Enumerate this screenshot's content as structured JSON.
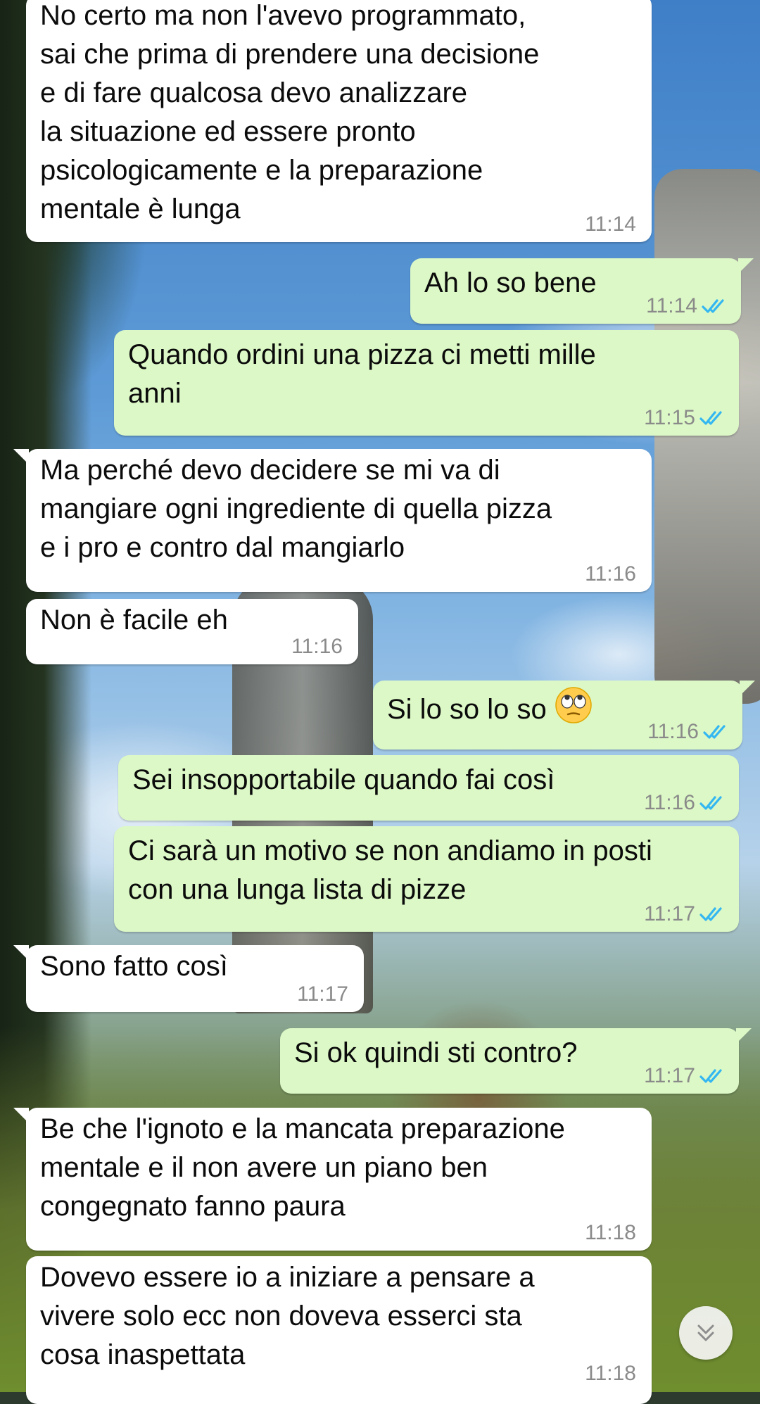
{
  "theme": {
    "incoming_bubble": "#ffffff",
    "outgoing_bubble": "#dcf8c6",
    "time_color": "#8a8a8a",
    "read_tick_color": "#34b7f1"
  },
  "messages": [
    {
      "dir": "in",
      "text": "No certo ma non l'avevo programmato,\nsai che prima di prendere una decisione\ne di fare qualcosa devo analizzare\nla situazione ed essere pronto\npsicologicamente e la preparazione\nmentale è lunga",
      "time": "11:14"
    },
    {
      "dir": "out",
      "text": "Ah lo so bene",
      "time": "11:14",
      "status": "read"
    },
    {
      "dir": "out",
      "text": "Quando ordini una pizza ci metti mille\nanni",
      "time": "11:15",
      "status": "read"
    },
    {
      "dir": "in",
      "text": "Ma perché devo decidere se mi va di\nmangiare ogni ingrediente di quella pizza\ne i pro e contro dal mangiarlo",
      "time": "11:16"
    },
    {
      "dir": "in",
      "text": "Non è facile eh",
      "time": "11:16"
    },
    {
      "dir": "out",
      "text": "Si lo so lo so",
      "emoji": "face-with-rolling-eyes",
      "time": "11:16",
      "status": "read"
    },
    {
      "dir": "out",
      "text": "Sei insopportabile quando fai così",
      "time": "11:16",
      "status": "read"
    },
    {
      "dir": "out",
      "text": "Ci sarà un motivo se non andiamo in posti\ncon una lunga lista di pizze",
      "time": "11:17",
      "status": "read"
    },
    {
      "dir": "in",
      "text": "Sono fatto così",
      "time": "11:17"
    },
    {
      "dir": "out",
      "text": "Si ok quindi sti contro?",
      "time": "11:17",
      "status": "read"
    },
    {
      "dir": "in",
      "text": "Be che l'ignoto e la mancata preparazione\nmentale e il non avere un piano ben\ncongegnato fanno paura",
      "time": "11:18"
    },
    {
      "dir": "in",
      "text": "Dovevo essere io a iniziare a pensare a\nvivere solo ecc non doveva esserci sta\ncosa inaspettata",
      "time": "11:18"
    }
  ],
  "scroll_button": {
    "icon": "double-chevron-down-icon"
  }
}
